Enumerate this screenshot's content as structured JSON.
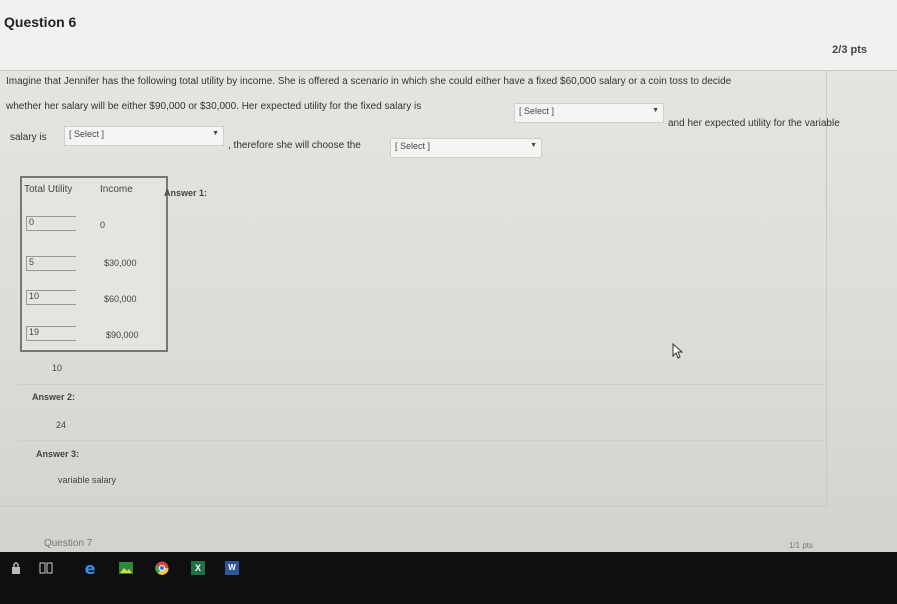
{
  "question": {
    "title": "Question 6",
    "points": "2/3 pts",
    "line1": "Imagine that Jennifer has the following total utility by income. She is offered a scenario in which she could either have a fixed $60,000 salary or a coin toss to decide",
    "line2": "whether her salary will be either $90,000 or $30,000. Her expected utility for the fixed salary is",
    "line2_after": "and her expected utility for the variable",
    "line3_before": "salary is",
    "line3_mid": ", therefore she will choose the",
    "select1": "[ Select ]",
    "select2": "[ Select ]",
    "select3": "[ Select ]"
  },
  "table": {
    "header_utility": "Total Utility",
    "header_income": "Income",
    "rows": [
      {
        "utility": "0",
        "income": "0"
      },
      {
        "utility": "5",
        "income": "$30,000"
      },
      {
        "utility": "10",
        "income": "$60,000"
      },
      {
        "utility": "19",
        "income": "$90,000"
      }
    ]
  },
  "answers": {
    "a1_label": "Answer 1:",
    "a1_value": "10",
    "a2_label": "Answer 2:",
    "a2_value": "24",
    "a3_label": "Answer 3:",
    "a3_value": "variable salary"
  },
  "next_question": {
    "title": "Question 7",
    "points": "1/1 pts"
  },
  "taskbar": {
    "icons": [
      "lock-icon",
      "task-view-icon",
      "edge-icon",
      "photos-icon",
      "chrome-icon",
      "excel-icon",
      "word-icon"
    ]
  }
}
